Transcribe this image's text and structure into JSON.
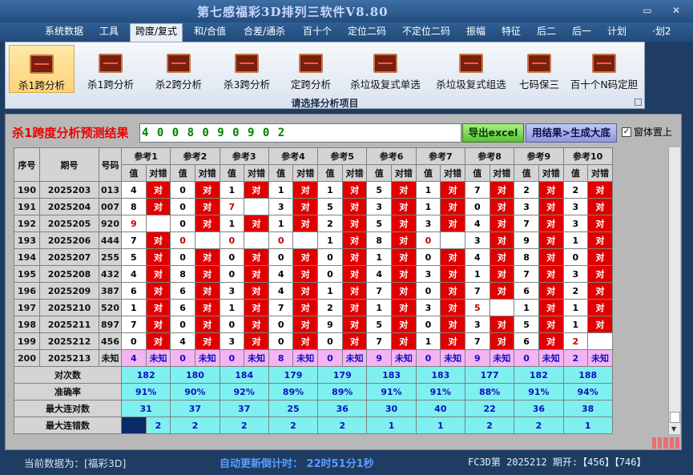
{
  "window": {
    "title": "第七感福彩3D排列三软件V8.80",
    "controls": [
      "—",
      "▭",
      "✕"
    ]
  },
  "menu": [
    "系统数据",
    "工具",
    "跨度/复式",
    "和/合值",
    "合差/通杀",
    "百十个",
    "定位二码",
    "不定位二码",
    "振幅",
    "特征",
    "后二",
    "后一",
    "计划",
    "·划2"
  ],
  "menu_active_index": 2,
  "ribbon": {
    "buttons": [
      "杀1跨分析",
      "杀1跨分析",
      "杀2跨分析",
      "杀3跨分析",
      "定跨分析",
      "杀垃圾复式单选",
      "杀垃圾复式组选",
      "七码保三",
      "百十个N码定胆"
    ],
    "selected_index": 0,
    "caption": "请选择分析项目"
  },
  "result": {
    "heading": "杀1跨度分析预测结果",
    "prediction": "4 0 0 8 0 9 0 9 0 2",
    "export_label": "导出excel",
    "generate_label": "用结果>生成大底",
    "checkbox_label": "窗体置上",
    "checkbox_checked": true
  },
  "table": {
    "headers": {
      "seq": "序号",
      "issue": "期号",
      "code": "号码",
      "refs": [
        "参考1",
        "参考2",
        "参考3",
        "参考4",
        "参考5",
        "参考6",
        "参考7",
        "参考8",
        "参考9",
        "参考10"
      ],
      "value": "值",
      "result": "对错"
    },
    "rows": [
      {
        "seq": "190",
        "issue": "2025203",
        "code": "013",
        "refs": [
          [
            "4",
            "对"
          ],
          [
            "0",
            "对"
          ],
          [
            "1",
            "对"
          ],
          [
            "1",
            "对"
          ],
          [
            "1",
            "对"
          ],
          [
            "5",
            "对"
          ],
          [
            "1",
            "对"
          ],
          [
            "7",
            "对"
          ],
          [
            "2",
            "对"
          ],
          [
            "2",
            "对"
          ]
        ]
      },
      {
        "seq": "191",
        "issue": "2025204",
        "code": "007",
        "refs": [
          [
            "8",
            "对"
          ],
          [
            "0",
            "对"
          ],
          [
            "7",
            ""
          ],
          [
            "3",
            "对"
          ],
          [
            "5",
            "对"
          ],
          [
            "3",
            "对"
          ],
          [
            "1",
            "对"
          ],
          [
            "0",
            "对"
          ],
          [
            "3",
            "对"
          ],
          [
            "3",
            "对"
          ]
        ]
      },
      {
        "seq": "192",
        "issue": "2025205",
        "code": "920",
        "refs": [
          [
            "9",
            ""
          ],
          [
            "0",
            "对"
          ],
          [
            "1",
            "对"
          ],
          [
            "1",
            "对"
          ],
          [
            "2",
            "对"
          ],
          [
            "5",
            "对"
          ],
          [
            "3",
            "对"
          ],
          [
            "4",
            "对"
          ],
          [
            "7",
            "对"
          ],
          [
            "3",
            "对"
          ]
        ]
      },
      {
        "seq": "193",
        "issue": "2025206",
        "code": "444",
        "refs": [
          [
            "7",
            "对"
          ],
          [
            "0",
            ""
          ],
          [
            "0",
            ""
          ],
          [
            "0",
            ""
          ],
          [
            "1",
            "对"
          ],
          [
            "8",
            "对"
          ],
          [
            "0",
            ""
          ],
          [
            "3",
            "对"
          ],
          [
            "9",
            "对"
          ],
          [
            "1",
            "对"
          ]
        ]
      },
      {
        "seq": "194",
        "issue": "2025207",
        "code": "255",
        "refs": [
          [
            "5",
            "对"
          ],
          [
            "0",
            "对"
          ],
          [
            "0",
            "对"
          ],
          [
            "0",
            "对"
          ],
          [
            "0",
            "对"
          ],
          [
            "1",
            "对"
          ],
          [
            "0",
            "对"
          ],
          [
            "4",
            "对"
          ],
          [
            "8",
            "对"
          ],
          [
            "0",
            "对"
          ]
        ]
      },
      {
        "seq": "195",
        "issue": "2025208",
        "code": "432",
        "refs": [
          [
            "4",
            "对"
          ],
          [
            "8",
            "对"
          ],
          [
            "0",
            "对"
          ],
          [
            "4",
            "对"
          ],
          [
            "0",
            "对"
          ],
          [
            "4",
            "对"
          ],
          [
            "3",
            "对"
          ],
          [
            "1",
            "对"
          ],
          [
            "7",
            "对"
          ],
          [
            "3",
            "对"
          ]
        ]
      },
      {
        "seq": "196",
        "issue": "2025209",
        "code": "387",
        "refs": [
          [
            "6",
            "对"
          ],
          [
            "6",
            "对"
          ],
          [
            "3",
            "对"
          ],
          [
            "4",
            "对"
          ],
          [
            "1",
            "对"
          ],
          [
            "7",
            "对"
          ],
          [
            "0",
            "对"
          ],
          [
            "7",
            "对"
          ],
          [
            "6",
            "对"
          ],
          [
            "2",
            "对"
          ]
        ]
      },
      {
        "seq": "197",
        "issue": "2025210",
        "code": "520",
        "refs": [
          [
            "1",
            "对"
          ],
          [
            "6",
            "对"
          ],
          [
            "1",
            "对"
          ],
          [
            "7",
            "对"
          ],
          [
            "2",
            "对"
          ],
          [
            "1",
            "对"
          ],
          [
            "3",
            "对"
          ],
          [
            "5",
            ""
          ],
          [
            "1",
            "对"
          ],
          [
            "1",
            "对"
          ]
        ]
      },
      {
        "seq": "198",
        "issue": "2025211",
        "code": "897",
        "refs": [
          [
            "7",
            "对"
          ],
          [
            "0",
            "对"
          ],
          [
            "0",
            "对"
          ],
          [
            "0",
            "对"
          ],
          [
            "9",
            "对"
          ],
          [
            "5",
            "对"
          ],
          [
            "0",
            "对"
          ],
          [
            "3",
            "对"
          ],
          [
            "5",
            "对"
          ],
          [
            "1",
            "对"
          ]
        ]
      },
      {
        "seq": "199",
        "issue": "2025212",
        "code": "456",
        "refs": [
          [
            "0",
            "对"
          ],
          [
            "4",
            "对"
          ],
          [
            "3",
            "对"
          ],
          [
            "0",
            "对"
          ],
          [
            "0",
            "对"
          ],
          [
            "7",
            "对"
          ],
          [
            "1",
            "对"
          ],
          [
            "7",
            "对"
          ],
          [
            "6",
            "对"
          ],
          [
            "2",
            ""
          ]
        ]
      },
      {
        "seq": "200",
        "issue": "2025213",
        "code": "未知",
        "refs": [
          [
            "4",
            "未知"
          ],
          [
            "0",
            "未知"
          ],
          [
            "0",
            "未知"
          ],
          [
            "8",
            "未知"
          ],
          [
            "0",
            "未知"
          ],
          [
            "9",
            "未知"
          ],
          [
            "0",
            "未知"
          ],
          [
            "9",
            "未知"
          ],
          [
            "0",
            "未知"
          ],
          [
            "2",
            "未知"
          ]
        ]
      }
    ],
    "stats": [
      {
        "label": "对次数",
        "values": [
          "182",
          "180",
          "184",
          "179",
          "179",
          "183",
          "183",
          "177",
          "182",
          "188"
        ]
      },
      {
        "label": "准确率",
        "values": [
          "91%",
          "90%",
          "92%",
          "89%",
          "89%",
          "91%",
          "91%",
          "88%",
          "91%",
          "94%"
        ]
      },
      {
        "label": "最大连对数",
        "values": [
          "31",
          "37",
          "37",
          "25",
          "36",
          "30",
          "40",
          "22",
          "36",
          "38"
        ]
      },
      {
        "label": "最大连错数",
        "values": [
          "2",
          "2",
          "2",
          "2",
          "2",
          "1",
          "1",
          "2",
          "2",
          "1"
        ]
      }
    ]
  },
  "status": {
    "left": "当前数据为：[福彩3D]",
    "center": "自动更新倒计时：  22时51分1秒",
    "right": "FC3D第 2025212 期开:【456】【746】"
  },
  "colors": {
    "hit": "#e00000",
    "predict_row": "#f4b4f4",
    "stats_bg": "#7ff0f0"
  }
}
